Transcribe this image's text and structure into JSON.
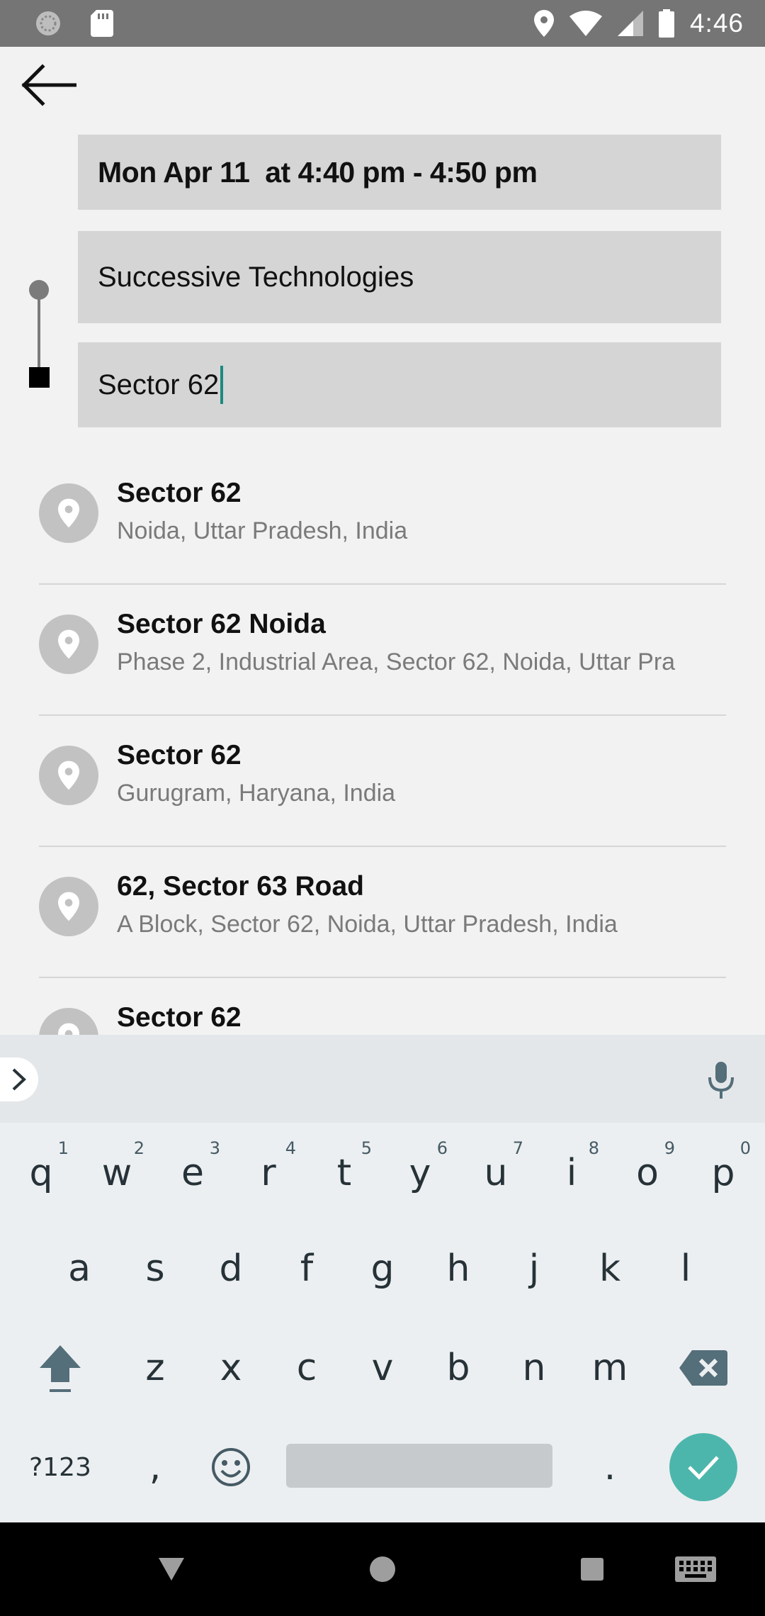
{
  "status_bar": {
    "time": "4:46",
    "icons": [
      "sync-icon",
      "sd-card-icon",
      "location-icon",
      "wifi-icon",
      "signal-icon",
      "battery-icon"
    ]
  },
  "trip": {
    "date_time": "Mon Apr 11  at 4:40 pm - 4:50 pm",
    "pickup": "Successive Technologies",
    "destination": "Sector 62"
  },
  "results": [
    {
      "title": "Sector 62",
      "subtitle": "Noida, Uttar Pradesh, India"
    },
    {
      "title": "Sector 62 Noida",
      "subtitle": "Phase 2, Industrial Area, Sector 62, Noida, Uttar Pra"
    },
    {
      "title": "Sector 62",
      "subtitle": "Gurugram, Haryana, India"
    },
    {
      "title": "62, Sector 63 Road",
      "subtitle": "A Block, Sector 62, Noida, Uttar Pradesh, India"
    },
    {
      "title": "Sector 62",
      "subtitle": ""
    }
  ],
  "keyboard": {
    "row1": [
      [
        "q",
        "1"
      ],
      [
        "w",
        "2"
      ],
      [
        "e",
        "3"
      ],
      [
        "r",
        "4"
      ],
      [
        "t",
        "5"
      ],
      [
        "y",
        "6"
      ],
      [
        "u",
        "7"
      ],
      [
        "i",
        "8"
      ],
      [
        "o",
        "9"
      ],
      [
        "p",
        "0"
      ]
    ],
    "row2": [
      "a",
      "s",
      "d",
      "f",
      "g",
      "h",
      "j",
      "k",
      "l"
    ],
    "row3": [
      "z",
      "x",
      "c",
      "v",
      "b",
      "n",
      "m"
    ],
    "symbols_label": "?123",
    "comma": ",",
    "period": ".",
    "accent_color": "#4db6ac"
  }
}
